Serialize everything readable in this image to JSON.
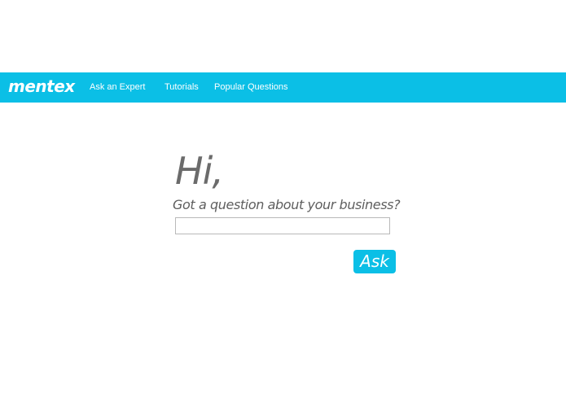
{
  "brand": {
    "logo_text": "mentex",
    "accent_color": "#0bbfe6"
  },
  "nav": {
    "items": [
      {
        "label": "Ask an Expert"
      },
      {
        "label": "Tutorials"
      },
      {
        "label": "Popular Questions"
      }
    ]
  },
  "main": {
    "greeting": "Hi,",
    "prompt": "Got a question about your business?",
    "question_input": {
      "value": "",
      "placeholder": ""
    },
    "ask_label": "Ask"
  }
}
